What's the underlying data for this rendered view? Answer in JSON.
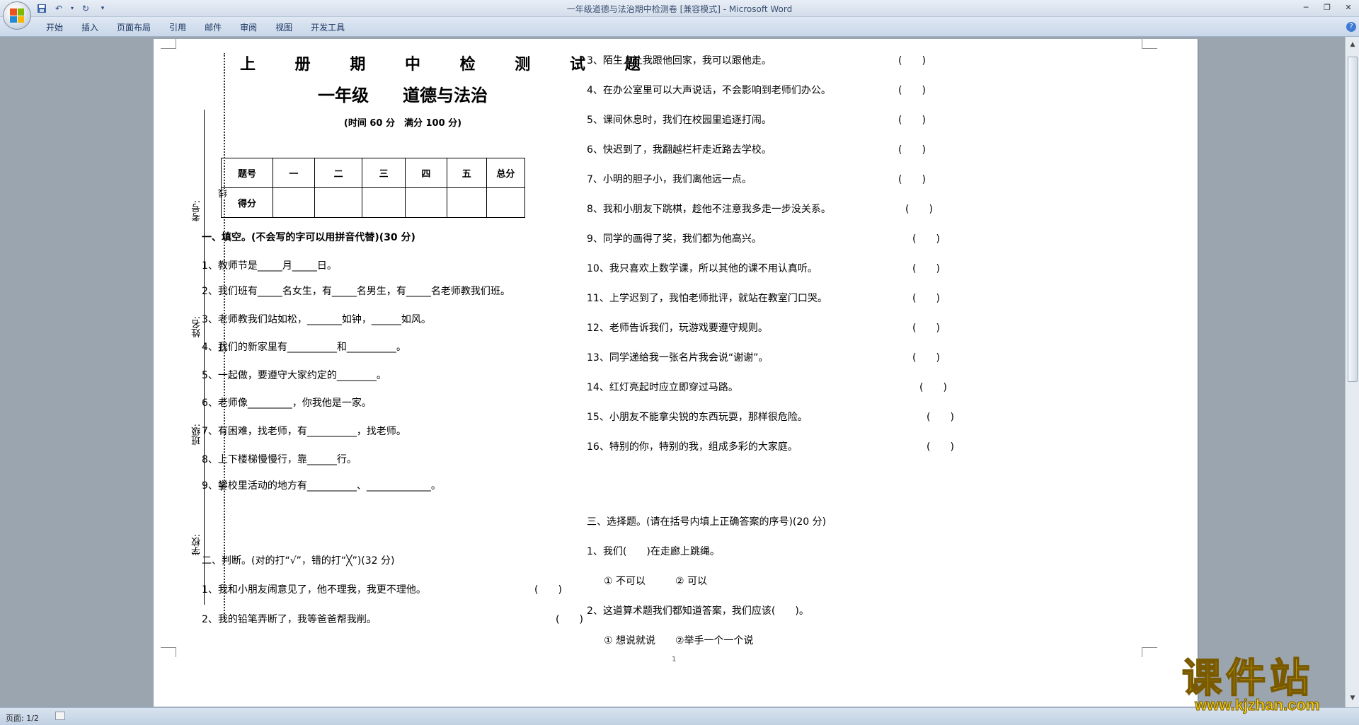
{
  "app": {
    "window_title": "一年级道德与法治期中检测卷 [兼容模式] - Microsoft Word",
    "ribbon_tabs": [
      "开始",
      "插入",
      "页面布局",
      "引用",
      "邮件",
      "审阅",
      "视图",
      "开发工具"
    ],
    "status_page": "页面: 1/2",
    "help": "?",
    "page_number": "1"
  },
  "watermark": {
    "main": "课件站",
    "url": "www.kjzhan.com"
  },
  "binding": {
    "labels": [
      "考号:",
      "姓名:",
      "班级:",
      "学校:"
    ],
    "marks": [
      "线",
      "订",
      "装"
    ]
  },
  "exam": {
    "title": "上 册 期 中 检 测 试 题",
    "subtitle": "一年级　　道德与法治",
    "meta": "(时间 60 分　满分 100 分)",
    "score_table": {
      "headers": [
        "题号",
        "一",
        "二",
        "三",
        "四",
        "五",
        "总分"
      ],
      "row_label": "得分"
    },
    "section1": {
      "heading": "一、填空。(不会写的字可以用拼音代替)(30 分)",
      "items": [
        "1、教师节是_____月_____日。",
        "2、我们班有_____名女生，有_____名男生，有_____名老师教我们班。",
        "3、老师教我们站如松，_______如钟，______如风。",
        "4、我们的新家里有__________和__________。",
        "5、一起做，要遵守大家约定的________。",
        "6、老师像_________，你我他是一家。",
        "7、有困难，找老师，有__________，找老师。",
        "8、上下楼梯慢慢行，靠______行。",
        "9、学校里活动的地方有__________、_____________。"
      ]
    },
    "section2": {
      "heading": "二、判断。(对的打“√”，错的打“╳”)(32 分)",
      "items": [
        "1、我和小朋友闹意见了，他不理我，我更不理他。",
        "2、我的铅笔弄断了，我等爸爸帮我削。",
        "3、陌生人让我跟他回家，我可以跟他走。",
        "4、在办公室里可以大声说话，不会影响到老师们办公。",
        "5、课间休息时，我们在校园里追逐打闹。",
        "6、快迟到了，我翻越栏杆走近路去学校。",
        "7、小明的胆子小，我们离他远一点。",
        "8、我和小朋友下跳棋，趁他不注意我多走一步没关系。",
        "9、同学的画得了奖，我们都为他高兴。",
        "10、我只喜欢上数学课，所以其他的课不用认真听。",
        "11、上学迟到了，我怕老师批评，就站在教室门口哭。",
        "12、老师告诉我们，玩游戏要遵守规则。",
        "13、同学递给我一张名片我会说“谢谢”。",
        "14、红灯亮起时应立即穿过马路。",
        "15、小朋友不能拿尖锐的东西玩耍，那样很危险。",
        "16、特别的你，特别的我，组成多彩的大家庭。"
      ],
      "blank": "(　　)"
    },
    "section3": {
      "heading": "三、选择题。(请在括号内填上正确答案的序号)(20 分)",
      "items": [
        "1、我们(　　)在走廊上跳绳。",
        "① 不可以　　　② 可以",
        "2、这道算术题我们都知道答案，我们应该(　　)。",
        "① 想说就说　　②举手一个一个说"
      ]
    }
  }
}
